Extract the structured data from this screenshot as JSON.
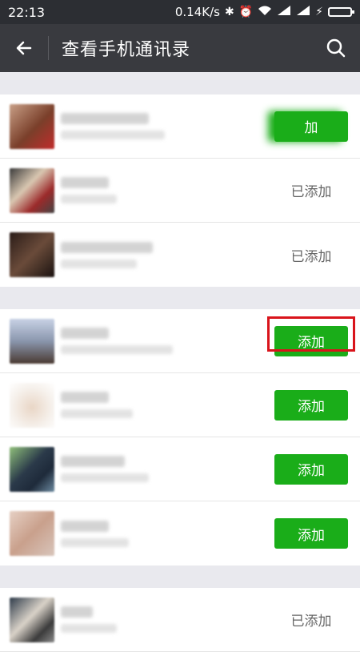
{
  "status": {
    "time": "22:13",
    "network_speed": "0.14K/s",
    "icons": [
      "bluetooth-icon",
      "alarm-icon",
      "wifi-icon",
      "signal-icon",
      "signal-icon",
      "charging-icon",
      "battery-icon"
    ]
  },
  "appbar": {
    "title": "查看手机通讯录",
    "back_icon": "back-arrow-icon",
    "search_icon": "search-icon"
  },
  "sections": [
    {
      "header": "",
      "contacts": [
        {
          "action": "加",
          "state": "add_partial"
        },
        {
          "action": "已添加",
          "state": "added"
        },
        {
          "action": "已添加",
          "state": "added"
        }
      ]
    },
    {
      "header": "",
      "contacts": [
        {
          "action": "添加",
          "state": "add",
          "highlighted": true
        },
        {
          "action": "添加",
          "state": "add"
        },
        {
          "action": "添加",
          "state": "add"
        },
        {
          "action": "添加",
          "state": "add"
        }
      ]
    },
    {
      "header": "",
      "contacts": [
        {
          "action": "已添加",
          "state": "added"
        }
      ]
    }
  ],
  "colors": {
    "statusbar": "#2c2e33",
    "appbar": "#393a3f",
    "add_button": "#1aad19",
    "highlight": "#d9141b"
  }
}
